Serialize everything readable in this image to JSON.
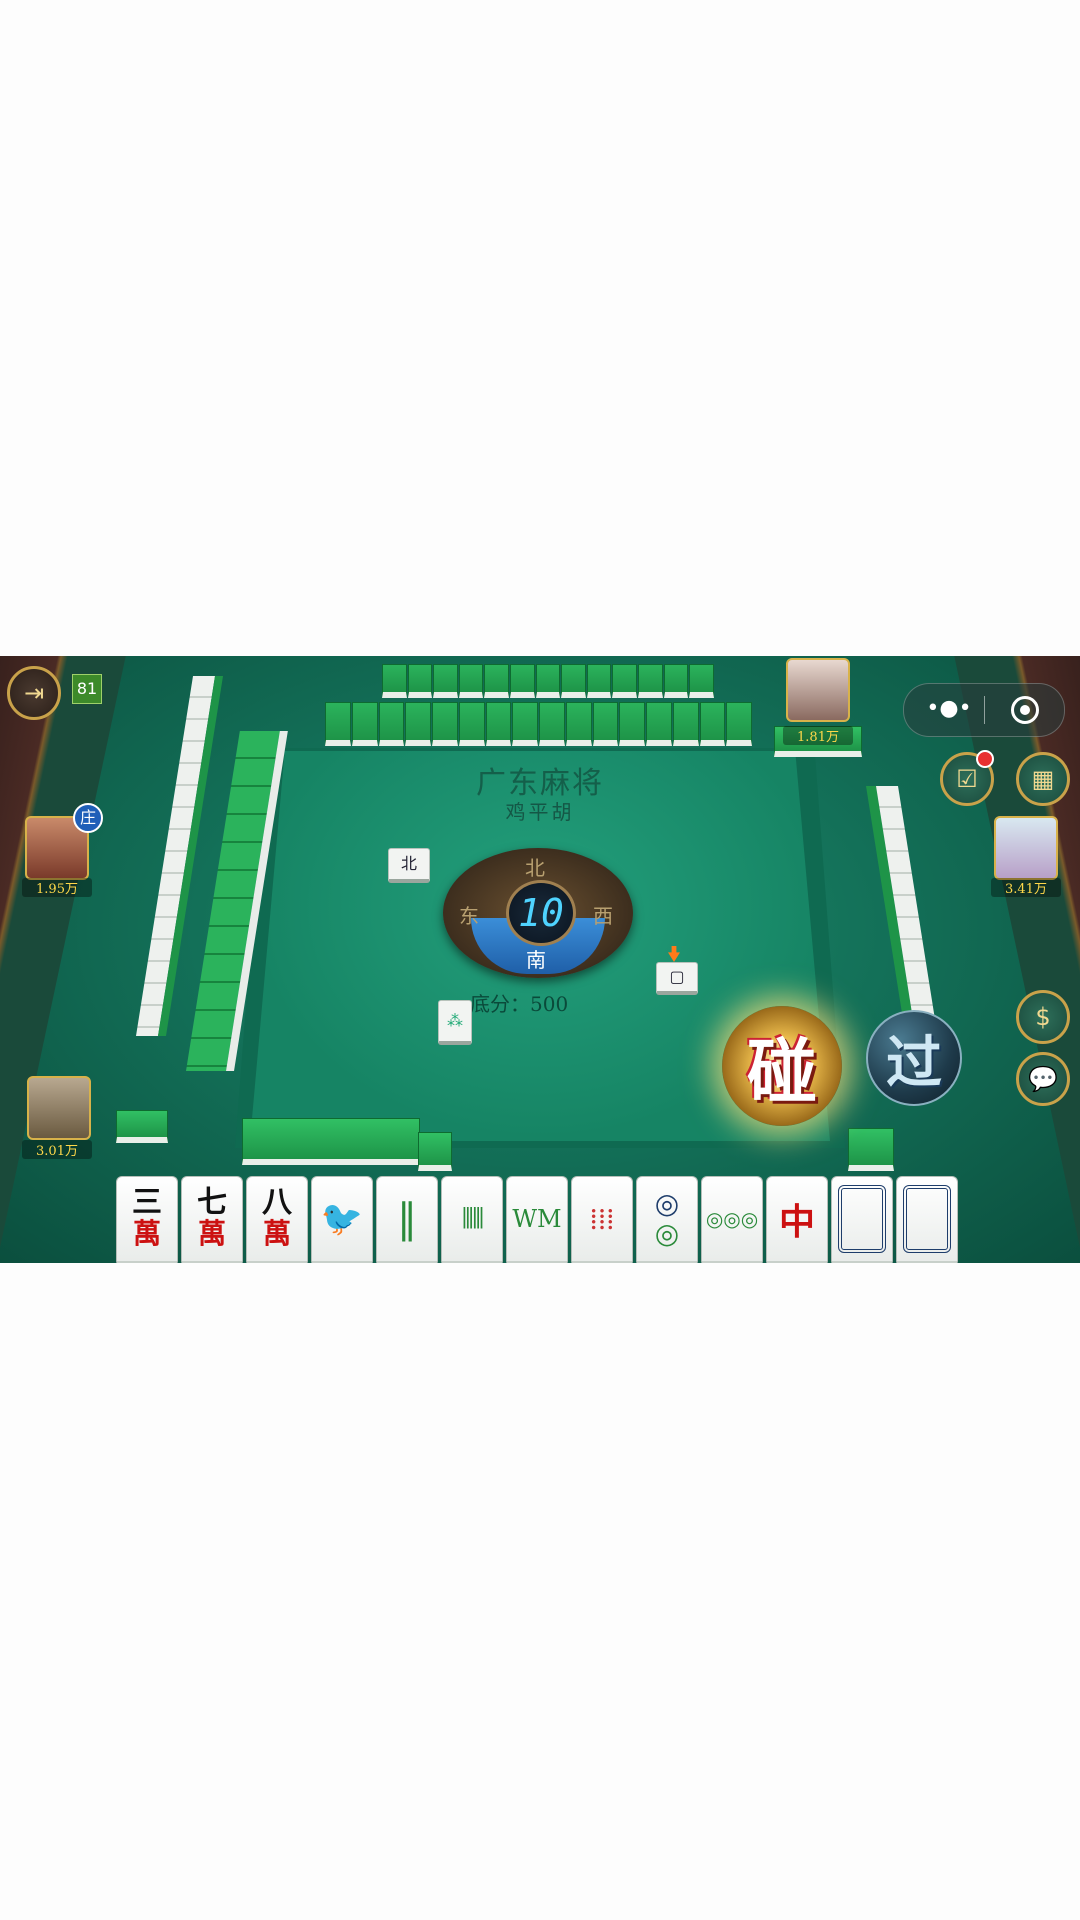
{
  "table": {
    "title": "广东麻将",
    "mode": "鸡平胡",
    "base_score": "底分：500"
  },
  "top_bar": {
    "level": "81",
    "capsule_more": "•●•"
  },
  "compass": {
    "north": "北",
    "west": "西",
    "east": "东",
    "south": "南",
    "timer": "10"
  },
  "players": {
    "left": {
      "score": "1.95万",
      "dealer_badge": "庄"
    },
    "top": {
      "score": "1.81万"
    },
    "right": {
      "score": "3.41万"
    },
    "self": {
      "score": "3.01万"
    }
  },
  "discards": {
    "left_discard": "北",
    "center_discard": "⁂",
    "right_discard": "▢"
  },
  "hand": [
    {
      "top": "三",
      "bottom": "萬"
    },
    {
      "top": "七",
      "bottom": "萬"
    },
    {
      "top": "八",
      "bottom": "萬"
    },
    {
      "top": "🐦",
      "bottom": ""
    },
    {
      "top": "‖",
      "bottom": ""
    },
    {
      "top": "⦀⦀",
      "bottom": ""
    },
    {
      "top": "WM",
      "bottom": ""
    },
    {
      "top": "⁞⁞⁞",
      "bottom": ""
    },
    {
      "top": "◎",
      "bottom": "◎"
    },
    {
      "top": "◎◎◎",
      "bottom": ""
    },
    {
      "top": "中",
      "bottom": ""
    },
    {
      "top": "",
      "bottom": ""
    },
    {
      "top": "",
      "bottom": ""
    }
  ],
  "actions": {
    "peng": "碰",
    "pass": "过"
  },
  "icons": {
    "exit": "exit-icon",
    "checkin": "calendar-check-icon",
    "menu": "grid-icon",
    "shop": "dollar-icon",
    "chat": "chat-icon"
  }
}
